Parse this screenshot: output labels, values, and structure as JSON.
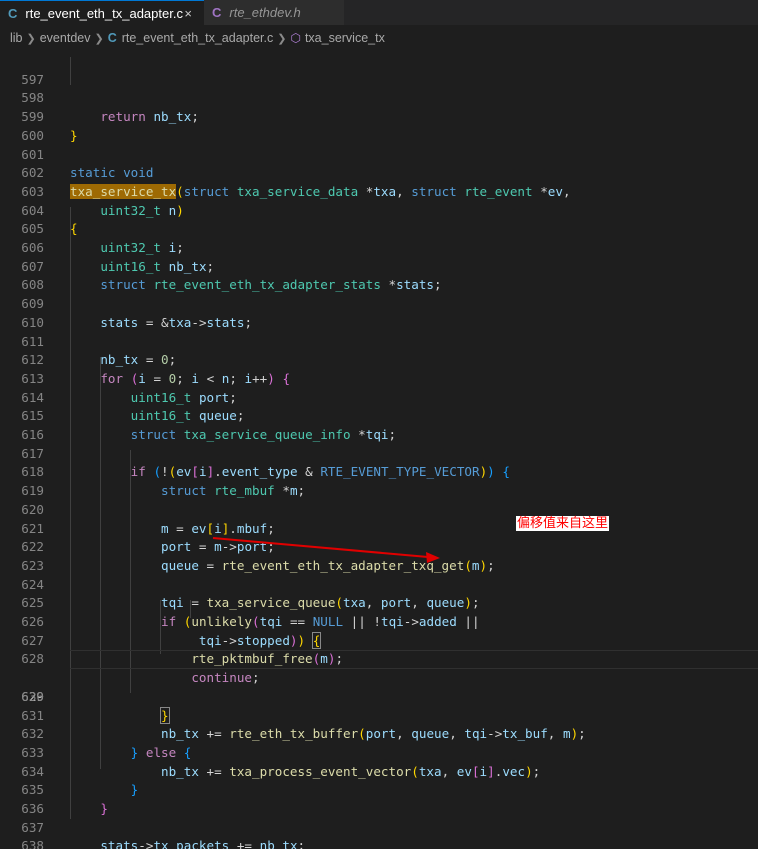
{
  "tabs": [
    {
      "icon": "C",
      "label": "rte_event_eth_tx_adapter.c",
      "close": "×"
    },
    {
      "icon": "C",
      "label": "rte_ethdev.h"
    }
  ],
  "breadcrumb": {
    "lib": "lib",
    "eventdev": "eventdev",
    "file_icon": "C",
    "file": "rte_event_eth_tx_adapter.c",
    "symbol": "txa_service_tx"
  },
  "lines": {
    "l597": "597",
    "l598": "598",
    "l599": "599",
    "l600": "600",
    "l601": "601",
    "l602": "602",
    "l603": "603",
    "l604": "604",
    "l605": "605",
    "l606": "606",
    "l607": "607",
    "l608": "608",
    "l609": "609",
    "l610": "610",
    "l611": "611",
    "l612": "612",
    "l613": "613",
    "l614": "614",
    "l615": "615",
    "l616": "616",
    "l617": "617",
    "l618": "618",
    "l619": "619",
    "l620": "620",
    "l621": "621",
    "l622": "622",
    "l623": "623",
    "l624": "624",
    "l625": "625",
    "l626": "626",
    "l627": "627",
    "l628": "628",
    "l629": "629",
    "l630": "630",
    "l631": "631",
    "l632": "632",
    "l633": "633",
    "l634": "634",
    "l635": "635",
    "l636": "636",
    "l637": "637",
    "l638": "638"
  },
  "code": {
    "return_kw": "return",
    "nb_tx": "nb_tx",
    "static_kw": "static",
    "void_kw": "void",
    "fn_name": "txa_service_tx",
    "struct_kw": "struct",
    "txa_service_data": "txa_service_data",
    "txa_param": "txa",
    "rte_event": "rte_event",
    "ev": "ev",
    "uint32_t": "uint32_t",
    "uint16_t": "uint16_t",
    "n": "n",
    "i": "i",
    "stats_struct": "rte_event_eth_tx_adapter_stats",
    "stats": "stats",
    "stats_field": "stats",
    "zero": "0",
    "for_kw": "for",
    "port": "port",
    "queue": "queue",
    "txa_service_queue_info": "txa_service_queue_info",
    "tqi": "tqi",
    "if_kw": "if",
    "event_type": "event_type",
    "vector_macro": "RTE_EVENT_TYPE_VECTOR",
    "rte_mbuf": "rte_mbuf",
    "m": "m",
    "mbuf": "mbuf",
    "txq_get": "rte_event_eth_tx_adapter_txq_get",
    "txa_service_queue": "txa_service_queue",
    "unlikely": "unlikely",
    "null_macro": "NULL",
    "added": "added",
    "stopped": "stopped",
    "pktmbuf_free": "rte_pktmbuf_free",
    "continue_kw": "continue",
    "tx_buffer": "rte_eth_tx_buffer",
    "tx_buf": "tx_buf",
    "else_kw": "else",
    "process_vector": "txa_process_event_vector",
    "vec": "vec",
    "tx_packets": "tx_packets"
  },
  "annotation": {
    "text": "偏移值来自这里",
    "color": "#ff0000"
  },
  "colors": {
    "background": "#1e1e1e",
    "keyword": "#569cd6",
    "control": "#c586c0",
    "type": "#4ec9b0",
    "function": "#dcdcaa",
    "variable": "#9cdcfe",
    "number": "#b5cea8",
    "highlight": "#9e6a03"
  }
}
